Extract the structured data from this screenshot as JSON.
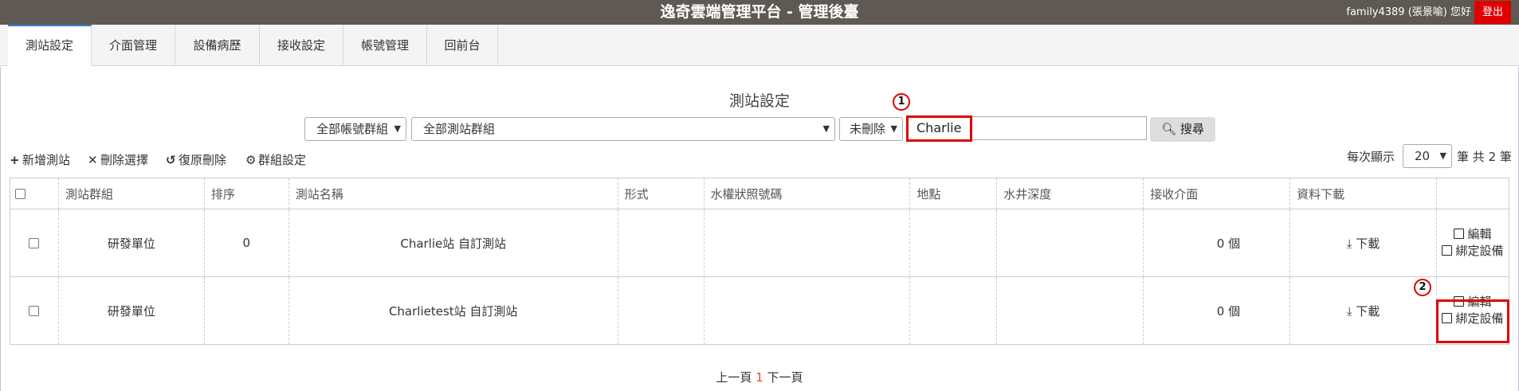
{
  "header": {
    "title": "逸奇雲端管理平台 - 管理後臺",
    "user": "family4389 (張景喻) 您好",
    "logout": "登出"
  },
  "tabs": [
    {
      "label": "測站設定",
      "active": true
    },
    {
      "label": "介面管理"
    },
    {
      "label": "設備病歷"
    },
    {
      "label": "接收設定"
    },
    {
      "label": "帳號管理"
    },
    {
      "label": "回前台"
    }
  ],
  "page_title": "測站設定",
  "filters": {
    "account_group": "全部帳號群組",
    "station_group": "全部測站群組",
    "deleted": "未刪除",
    "keyword": "Charlie",
    "search_btn": "搜尋"
  },
  "toolbar": {
    "add": "新增測站",
    "delete": "刪除選擇",
    "restore": "復原刪除",
    "group": "群組設定"
  },
  "paging": {
    "per_page_label": "每次顯示",
    "per_page": "20",
    "total_prefix": "筆 共",
    "total": "2",
    "total_suffix": "筆"
  },
  "table": {
    "headers": [
      "測站群組",
      "排序",
      "測站名稱",
      "形式",
      "水權狀照號碼",
      "地點",
      "水井深度",
      "接收介面",
      "資料下載"
    ],
    "rows": [
      {
        "group": "研發單位",
        "order": "0",
        "name": "Charlie站 自訂測站",
        "type": "",
        "permit": "",
        "location": "",
        "depth": "",
        "iface": "0 個",
        "download": "下載",
        "edit": "編輯",
        "bind": "綁定設備"
      },
      {
        "group": "研發單位",
        "order": "",
        "name": "Charlietest站 自訂測站",
        "type": "",
        "permit": "",
        "location": "",
        "depth": "",
        "iface": "0 個",
        "download": "下載",
        "edit": "編輯",
        "bind": "綁定設備"
      }
    ]
  },
  "annotations": {
    "badge1": "1",
    "badge2": "2"
  },
  "pager": {
    "prev": "上一頁",
    "current": "1",
    "next": "下一頁"
  },
  "colors": {
    "topbar": "#5e5a53",
    "logout": "#e00000",
    "highlight": "#e00000",
    "active_tab": "#3a78d0"
  }
}
